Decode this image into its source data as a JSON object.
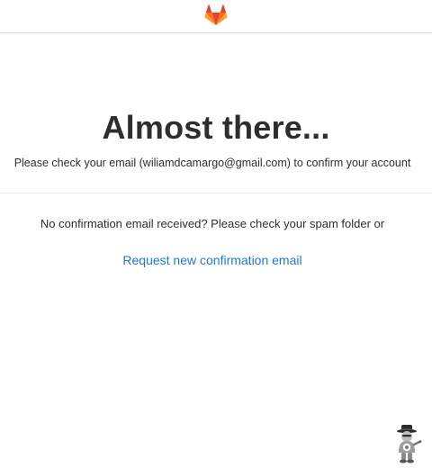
{
  "header": {
    "logo_icon": "gitlab-tanuki-icon",
    "logo_colors": {
      "dark": "#e24329",
      "mid": "#fc6d26",
      "light": "#fca326"
    }
  },
  "main": {
    "title": "Almost there...",
    "subtitle": "Please check your email (wiliamdcamargo@gmail.com) to confirm your account",
    "notice": "No confirmation email received? Please check your spam folder or",
    "resend_link": "Request new confirmation email"
  },
  "colors": {
    "text": "#2e2e2e",
    "link": "#1f78d1",
    "divider": "#e9e9e9",
    "header_border": "#dbdbdb"
  },
  "corner_widget": {
    "icon": "spy-mascot-icon"
  }
}
